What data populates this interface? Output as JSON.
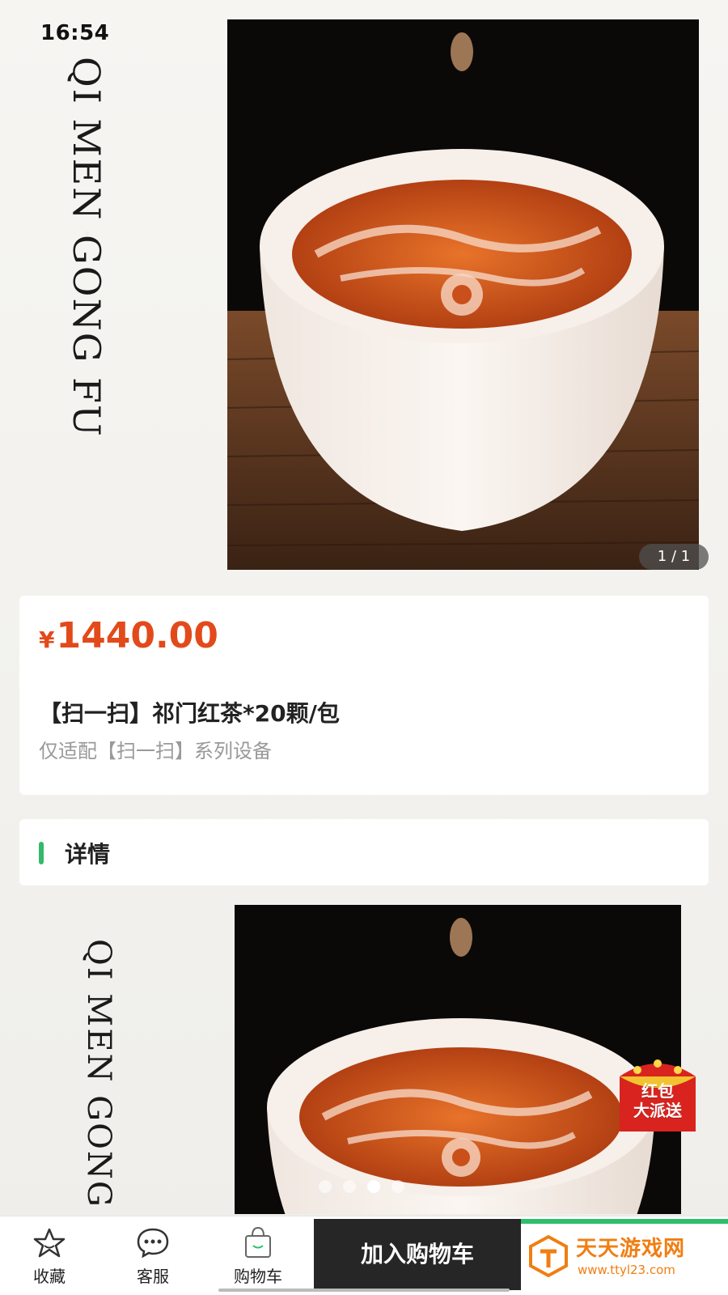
{
  "status_bar": {
    "time": "16:54"
  },
  "hero": {
    "brand_vertical": "QI MEN GONG FU",
    "pager": "1 / 1"
  },
  "product": {
    "currency": "¥",
    "price": "1440.00",
    "title": "【扫一扫】祁门红茶*20颗/包",
    "subtitle": "仅适配【扫一扫】系列设备"
  },
  "details": {
    "heading": "详情",
    "brand_vertical": "QI MEN GONG FU",
    "carousel": {
      "count": 4,
      "active_index": 2
    }
  },
  "red_packet": {
    "line1": "红包",
    "line2": "大派送"
  },
  "tabbar": {
    "favorites": {
      "label": "收藏",
      "icon": "star-icon"
    },
    "service": {
      "label": "客服",
      "icon": "chat-icon"
    },
    "cart": {
      "label": "购物车",
      "icon": "shopping-bag-icon"
    },
    "add_to_cart": "加入购物车"
  },
  "watermark": {
    "name": "天天游戏网",
    "url": "www.ttyl23.com"
  },
  "colors": {
    "price": "#e24a1b",
    "accent_green": "#35b86a",
    "button_dark": "#262626",
    "watermark_orange": "#f07e12"
  }
}
